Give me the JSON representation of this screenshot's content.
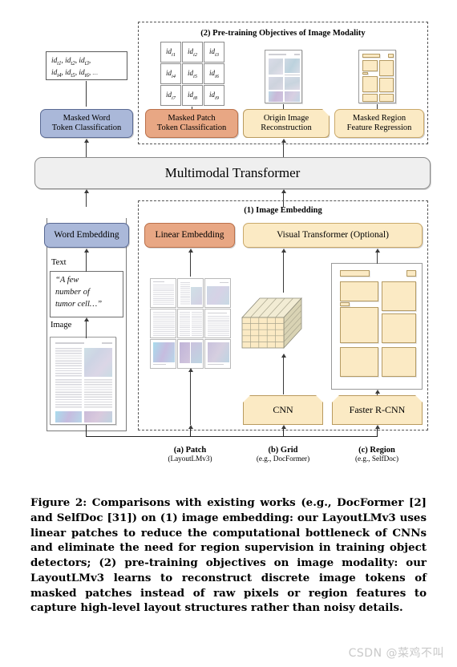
{
  "figure": {
    "groups": {
      "objectives": {
        "title": "(2) Pre-training Objectives of Image Modality"
      },
      "embedding": {
        "title": "(1) Image Embedding"
      }
    },
    "text_token_ids": {
      "line1": "idₜ₁, idₜ₂, idₜ₃,",
      "line2": "idₜ₄, idₜ₅, idₜ₆, …"
    },
    "image_token_ids": [
      "id i1",
      "id i2",
      "id i3",
      "id i4",
      "id i5",
      "id i6",
      "id i7",
      "id i8",
      "id i9"
    ],
    "boxes": {
      "masked_word_token_classification": "Masked Word\nToken Classification",
      "masked_patch_token_classification": "Masked Patch\nToken Classification",
      "origin_image_reconstruction": "Origin Image\nReconstruction",
      "masked_region_feature_regression": "Masked Region\nFeature Regression",
      "multimodal_transformer": "Multimodal Transformer",
      "word_embedding": "Word Embedding",
      "linear_embedding": "Linear Embedding",
      "visual_transformer": "Visual Transformer (Optional)",
      "cnn": "CNN",
      "faster_rcnn": "Faster R-CNN"
    },
    "inputs": {
      "text_label": "Text",
      "image_label": "Image",
      "text_snippet": "“A few\nnumber of\ntumor cell…”"
    },
    "bottom_labels": [
      {
        "title": "(a) Patch",
        "sub": "(LayoutLMv3)"
      },
      {
        "title": "(b) Grid",
        "sub": "(e.g., DocFormer)"
      },
      {
        "title": "(c) Region",
        "sub": "(e.g., SelfDoc)"
      }
    ],
    "colors": {
      "blue": "#aab8d9",
      "orange": "#e8a784",
      "cream": "#fbeac4",
      "grey": "#efefef",
      "stroke": "#3a3a3a"
    }
  },
  "caption": {
    "text": "Figure 2: Comparisons with existing works (e.g., DocFormer [2] and SelfDoc [31]) on (1) image embedding: our LayoutLMv3 uses linear patches to reduce the computational bottleneck of CNNs and eliminate the need for region supervision in training object detectors; (2) pre-training objectives on image modality: our LayoutLMv3 learns to reconstruct discrete image tokens of masked patches instead of raw pixels or region features to capture high-level layout structures rather than noisy details."
  },
  "watermark": {
    "text": "CSDN @菜鸡不叫"
  }
}
